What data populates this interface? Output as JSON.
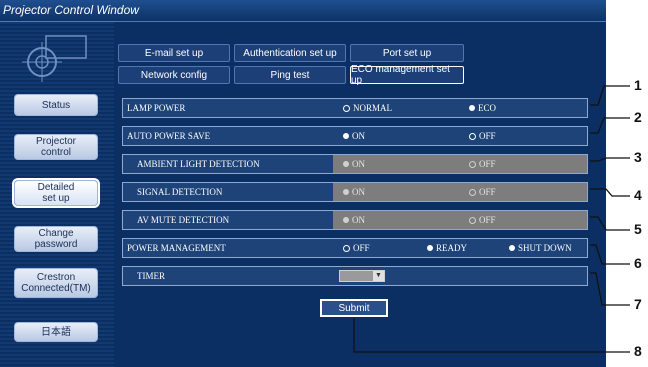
{
  "window": {
    "title": "Projector Control Window"
  },
  "sidebar": {
    "items": [
      {
        "label": "Status"
      },
      {
        "label": "Projector\ncontrol"
      },
      {
        "label": "Detailed\nset up"
      },
      {
        "label": "Change\npassword"
      },
      {
        "label": "Crestron\nConnected(TM)"
      },
      {
        "label": "日本語"
      }
    ]
  },
  "tabs": [
    {
      "label": "E-mail set up"
    },
    {
      "label": "Authentication set up"
    },
    {
      "label": "Port set up"
    },
    {
      "label": "Network config"
    },
    {
      "label": "Ping test"
    },
    {
      "label": "ECO management set up"
    }
  ],
  "settings": {
    "lamp_power": {
      "label": "LAMP POWER",
      "options": [
        "NORMAL",
        "ECO"
      ],
      "selected": "NORMAL"
    },
    "auto_power_save": {
      "label": "AUTO POWER SAVE",
      "options": [
        "ON",
        "OFF"
      ],
      "selected": "OFF"
    },
    "ambient_light": {
      "label": "AMBIENT LIGHT DETECTION",
      "options": [
        "ON",
        "OFF"
      ],
      "selected": "OFF"
    },
    "signal_detection": {
      "label": "SIGNAL DETECTION",
      "options": [
        "ON",
        "OFF"
      ],
      "selected": "OFF"
    },
    "av_mute_detection": {
      "label": "AV MUTE DETECTION",
      "options": [
        "ON",
        "OFF"
      ],
      "selected": "OFF"
    },
    "power_management": {
      "label": "POWER MANAGEMENT",
      "options": [
        "OFF",
        "READY",
        "SHUT DOWN"
      ],
      "selected": "OFF"
    },
    "timer": {
      "label": "TIMER",
      "value": ""
    }
  },
  "submit_label": "Submit",
  "callouts": [
    "1",
    "2",
    "3",
    "4",
    "5",
    "6",
    "7",
    "8"
  ]
}
